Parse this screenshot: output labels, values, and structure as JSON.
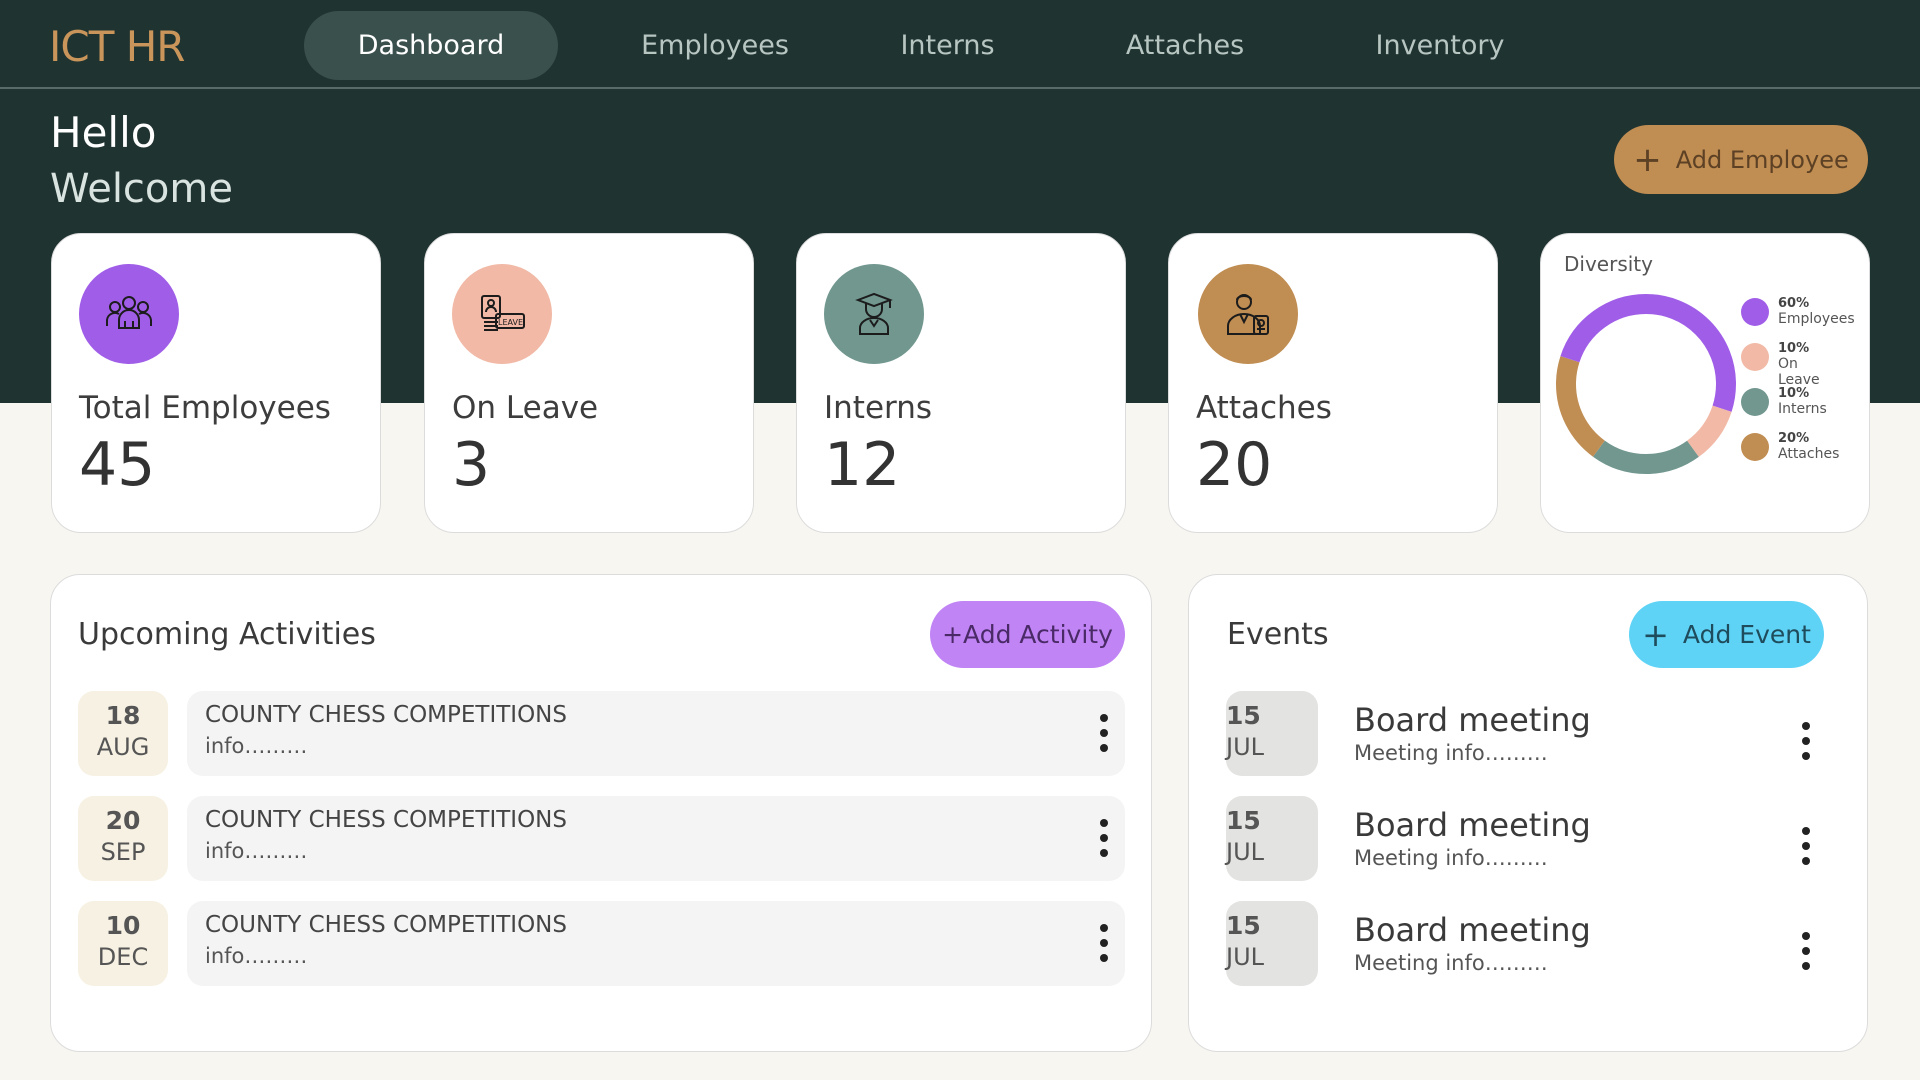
{
  "app": {
    "logo": "ICT HR"
  },
  "nav": {
    "items": [
      {
        "label": "Dashboard",
        "active": true
      },
      {
        "label": "Employees",
        "active": false
      },
      {
        "label": "Interns",
        "active": false
      },
      {
        "label": "Attaches",
        "active": false
      },
      {
        "label": "Inventory",
        "active": false
      }
    ]
  },
  "greeting": {
    "hello": "Hello",
    "welcome": "Welcome"
  },
  "actions": {
    "add_employee": "Add Employee",
    "plus": "+"
  },
  "stats": [
    {
      "label": "Total Employees",
      "value": "45",
      "color": "#a05ee8",
      "icon": "employees-group-icon"
    },
    {
      "label": "On Leave",
      "value": "3",
      "color": "#f1b9a6",
      "icon": "leave-badge-icon"
    },
    {
      "label": "Interns",
      "value": "12",
      "color": "#71978f",
      "icon": "graduate-icon"
    },
    {
      "label": "Attaches",
      "value": "20",
      "color": "#c08d52",
      "icon": "attache-person-icon"
    }
  ],
  "diversity": {
    "title": "Diversity",
    "legend": [
      {
        "pct": "60%",
        "name": "Employees",
        "color": "#a05ee8"
      },
      {
        "pct": "10%",
        "name": "On Leave",
        "color": "#f1b9a6"
      },
      {
        "pct": "10%",
        "name": "Interns",
        "color": "#71978f"
      },
      {
        "pct": "20%",
        "name": "Attaches",
        "color": "#c08d52"
      }
    ]
  },
  "activities": {
    "title": "Upcoming Activities",
    "add_label": "+Add Activity",
    "items": [
      {
        "day": "18",
        "month": "AUG",
        "title": "COUNTY CHESS COMPETITIONS",
        "info": "info………"
      },
      {
        "day": "20",
        "month": "SEP",
        "title": "COUNTY CHESS COMPETITIONS",
        "info": "info………"
      },
      {
        "day": "10",
        "month": "DEC",
        "title": "COUNTY CHESS COMPETITIONS",
        "info": "info………"
      }
    ]
  },
  "events": {
    "title": "Events",
    "add_label": "Add Event",
    "items": [
      {
        "day": "15",
        "month": "JUL",
        "title": "Board meeting",
        "info": "Meeting info………"
      },
      {
        "day": "15",
        "month": "JUL",
        "title": "Board meeting",
        "info": "Meeting info………"
      },
      {
        "day": "15",
        "month": "JUL",
        "title": "Board meeting",
        "info": "Meeting info………"
      }
    ]
  }
}
